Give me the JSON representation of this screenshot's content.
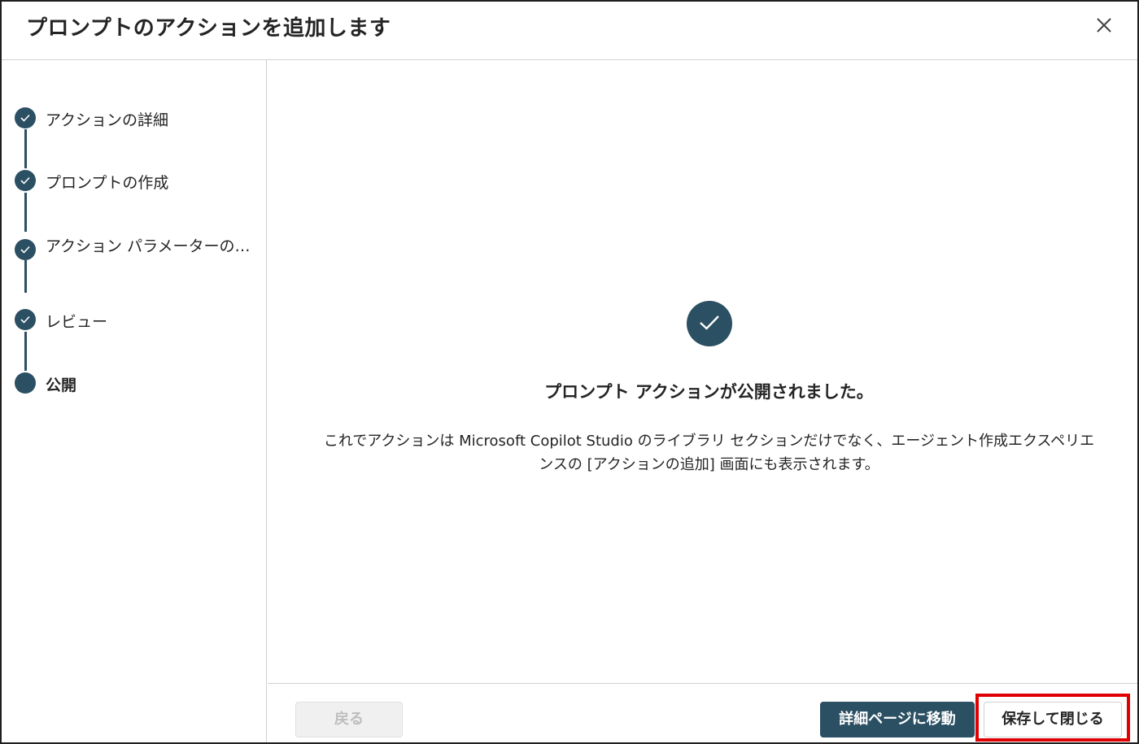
{
  "dialog": {
    "title": "プロンプトのアクションを追加します"
  },
  "steps": [
    {
      "label": "アクションの詳細",
      "status": "completed"
    },
    {
      "label": "プロンプトの作成",
      "status": "completed"
    },
    {
      "label": "アクション パラメーターの…",
      "status": "completed"
    },
    {
      "label": "レビュー",
      "status": "completed"
    },
    {
      "label": "公開",
      "status": "current"
    }
  ],
  "main": {
    "success_icon": "check-icon",
    "success_title": "プロンプト アクションが公開されました。",
    "success_body": "これでアクションは Microsoft Copilot Studio のライブラリ セクションだけでなく、エージェント作成エクスペリエンスの [アクションの追加] 画面にも表示されます。"
  },
  "footer": {
    "back_label": "戻る",
    "details_label": "詳細ページに移動",
    "save_close_label": "保存して閉じる"
  },
  "colors": {
    "accent": "#2b4f63",
    "highlight": "#e00000"
  }
}
